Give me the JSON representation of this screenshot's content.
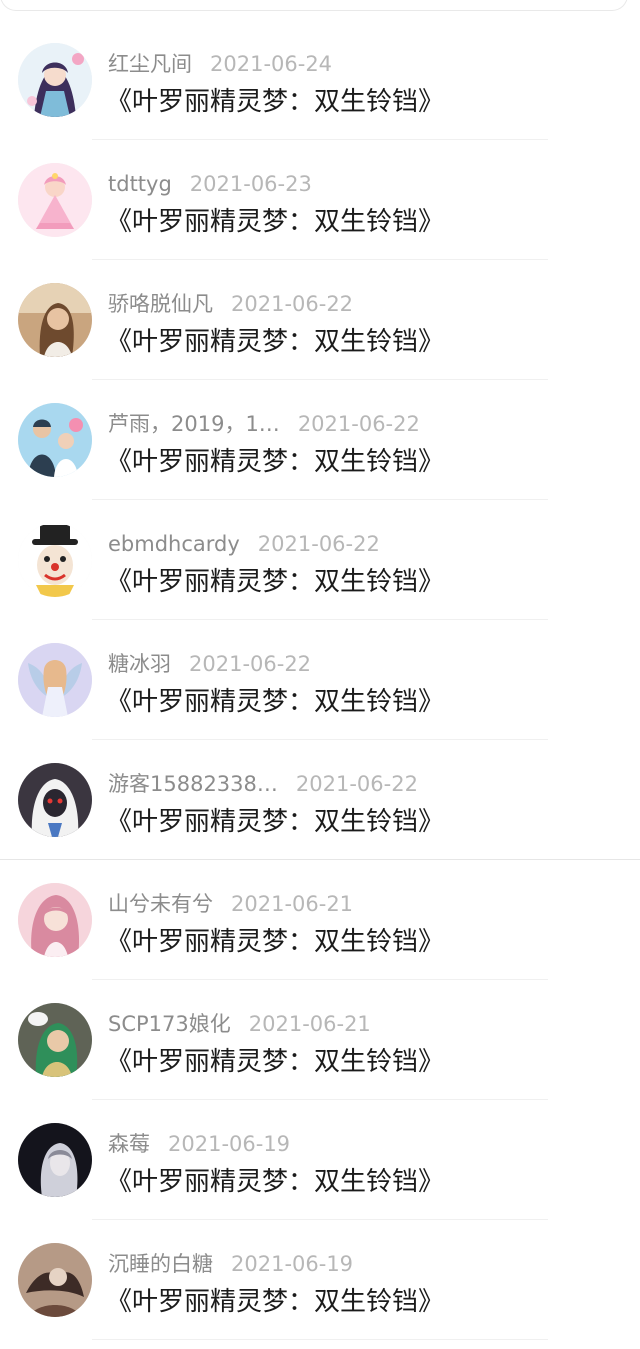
{
  "comments": [
    {
      "username": "红尘凡间",
      "date": "2021-06-24",
      "title": "《叶罗丽精灵梦：双生铃铛》",
      "avatar": {
        "icon": "anime-girl-avatar",
        "bg": "#e9f2f8",
        "accent": "#3d2f5c"
      }
    },
    {
      "username": "tdttyg",
      "date": "2021-06-23",
      "title": "《叶罗丽精灵梦：双生铃铛》",
      "avatar": {
        "icon": "pink-princess-avatar",
        "bg": "#fde6ef",
        "accent": "#f29cbc"
      }
    },
    {
      "username": "骄咯脱仙凡",
      "date": "2021-06-22",
      "title": "《叶罗丽精灵梦：双生铃铛》",
      "avatar": {
        "icon": "woman-photo-avatar",
        "bg": "#c9a57f",
        "accent": "#6e4a2e"
      }
    },
    {
      "username": "芦雨，2019，1…",
      "date": "2021-06-22",
      "title": "《叶罗丽精灵梦：双生铃铛》",
      "avatar": {
        "icon": "family-photo-avatar",
        "bg": "#a9d8ef",
        "accent": "#2c3e50"
      }
    },
    {
      "username": "ebmdhcardy",
      "date": "2021-06-22",
      "title": "《叶罗丽精灵梦：双生铃铛》",
      "avatar": {
        "icon": "clown-avatar",
        "bg": "#ffffff",
        "accent": "#d9332b"
      }
    },
    {
      "username": "糖冰羽",
      "date": "2021-06-22",
      "title": "《叶罗丽精灵梦：双生铃铛》",
      "avatar": {
        "icon": "fairy-avatar",
        "bg": "#d9d6f2",
        "accent": "#e7b98d"
      }
    },
    {
      "username": "游客15882338…",
      "date": "2021-06-22",
      "title": "《叶罗丽精灵梦：双生铃铛》",
      "avatar": {
        "icon": "hooded-figure-avatar",
        "bg": "#3b3640",
        "accent": "#f2f2f2"
      }
    },
    {
      "username": "山兮未有兮",
      "date": "2021-06-21",
      "title": "《叶罗丽精灵梦：双生铃铛》",
      "avatar": {
        "icon": "pink-hair-girl-avatar",
        "bg": "#f6d5dc",
        "accent": "#d98aa0"
      }
    },
    {
      "username": "SCP173娘化",
      "date": "2021-06-21",
      "title": "《叶罗丽精灵梦：双生铃铛》",
      "avatar": {
        "icon": "green-hair-character-avatar",
        "bg": "#5f6356",
        "accent": "#2f8f5a"
      }
    },
    {
      "username": "森莓",
      "date": "2021-06-19",
      "title": "《叶罗丽精灵梦：双生铃铛》",
      "avatar": {
        "icon": "dark-girl-avatar",
        "bg": "#14141c",
        "accent": "#cfd0da"
      }
    },
    {
      "username": "沉睡的白糖",
      "date": "2021-06-19",
      "title": "《叶罗丽精灵梦：双生铃铛》",
      "avatar": {
        "icon": "ink-painting-avatar",
        "bg": "#b69a86",
        "accent": "#3d2b26"
      }
    }
  ]
}
